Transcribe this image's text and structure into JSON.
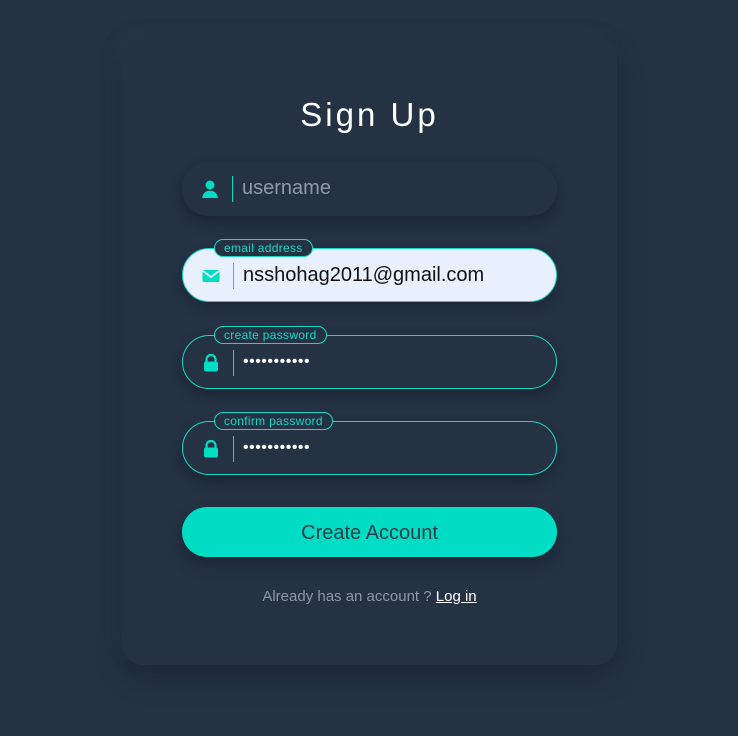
{
  "app": {
    "title": "Sign Up"
  },
  "form": {
    "username": {
      "placeholder": "username",
      "value": ""
    },
    "email": {
      "label": "email address",
      "value": "nsshohag2011@gmail.com"
    },
    "create_password": {
      "label": "create password",
      "value": "•••••••••••"
    },
    "confirm_password": {
      "label": "confirm password",
      "value": "•••••••••••"
    }
  },
  "actions": {
    "create_account_label": "Create Account"
  },
  "footer": {
    "prompt": "Already has an account ?",
    "login_label": "Log in"
  },
  "icons": {
    "username": "user-icon",
    "email": "mail-icon",
    "password": "lock-icon"
  },
  "colors": {
    "background": "#243244",
    "accent": "#00ddc4",
    "email_fill": "#e8f0fe",
    "muted_text": "#8d98a5"
  }
}
